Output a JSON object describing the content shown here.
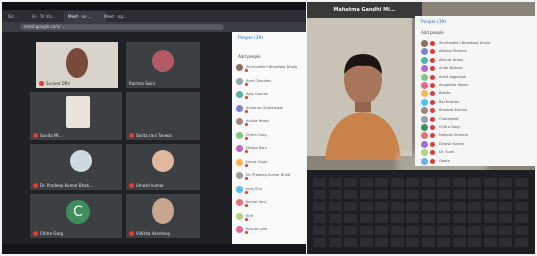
{
  "left_photo": {
    "tabs": [
      "Sir...",
      "Ai - Tri Vin...",
      "Meet - sc-...",
      "Meet - xg..."
    ],
    "address": "meet.google.com/...",
    "tiles": [
      {
        "name": "Surjeet DRV",
        "avatar": "photo"
      },
      {
        "name": "Rachna Saini",
        "avatar": "photo"
      },
      {
        "name": "Sunita Mi...",
        "avatar": "photo"
      },
      {
        "name": "Sarita rani Tanwar",
        "avatar": "none"
      },
      {
        "name": "Dr. Pradeep Kumar Bhati...",
        "avatar": "photo"
      },
      {
        "name": "Umesh kumar",
        "avatar": "photo"
      },
      {
        "name": "Chitra Garg",
        "avatar": "letter",
        "letter": "C",
        "color": "#3f8f5c"
      },
      {
        "name": "Vidisha Varshney",
        "avatar": "photo"
      }
    ],
    "side_panel": {
      "header": "People (39)",
      "add_people": "Add people",
      "rows": [
        "Shrimadhini Bhardwaj Dhola",
        "Amit Chauhan",
        "Ajay Gaurav",
        "Anubhav Shekhawat",
        "Ankita Yadav",
        "Chitra Garg",
        "Deepa Rani",
        "Divya Singh",
        "Dr. Pradeep Kumar Bhati",
        "Indu Shri",
        "Kamal Devi",
        "Kirti",
        "Kusum Lata"
      ],
      "row_colors": [
        "#8d6e63",
        "#90a4ae",
        "#4db6ac",
        "#7986cb",
        "#a1887f",
        "#81c784",
        "#ba68c8",
        "#ffb74d",
        "#9e9e9e",
        "#4fc3f7",
        "#e57373",
        "#aed581",
        "#f06292"
      ]
    }
  },
  "right_photo": {
    "title": "Mahatma Gandhi Mi...",
    "side_panel": {
      "header": "People (39)",
      "add_people": "Add people",
      "rows": [
        "Shrimadhini Bhardwaj Dhola",
        "Abhiral Sharma",
        "Akshat Yadav",
        "Anita Bishnoi",
        "Ankit Aggarwal",
        "Anupama Yadav",
        "Babita",
        "Bal Krishan",
        "Bhawna Kumari",
        "Charanjeet",
        "Chitra Garg",
        "Deepak Sharma",
        "Dinesh Kumar",
        "Dr. Sunil",
        "Geeta"
      ],
      "row_colors": [
        "#8d6e63",
        "#7986cb",
        "#4db6ac",
        "#ba68c8",
        "#81c784",
        "#f06292",
        "#ffb74d",
        "#4fc3f7",
        "#a1887f",
        "#90a4ae",
        "#3f8f5c",
        "#e57373",
        "#9575cd",
        "#aed581",
        "#64b5f6"
      ]
    }
  }
}
